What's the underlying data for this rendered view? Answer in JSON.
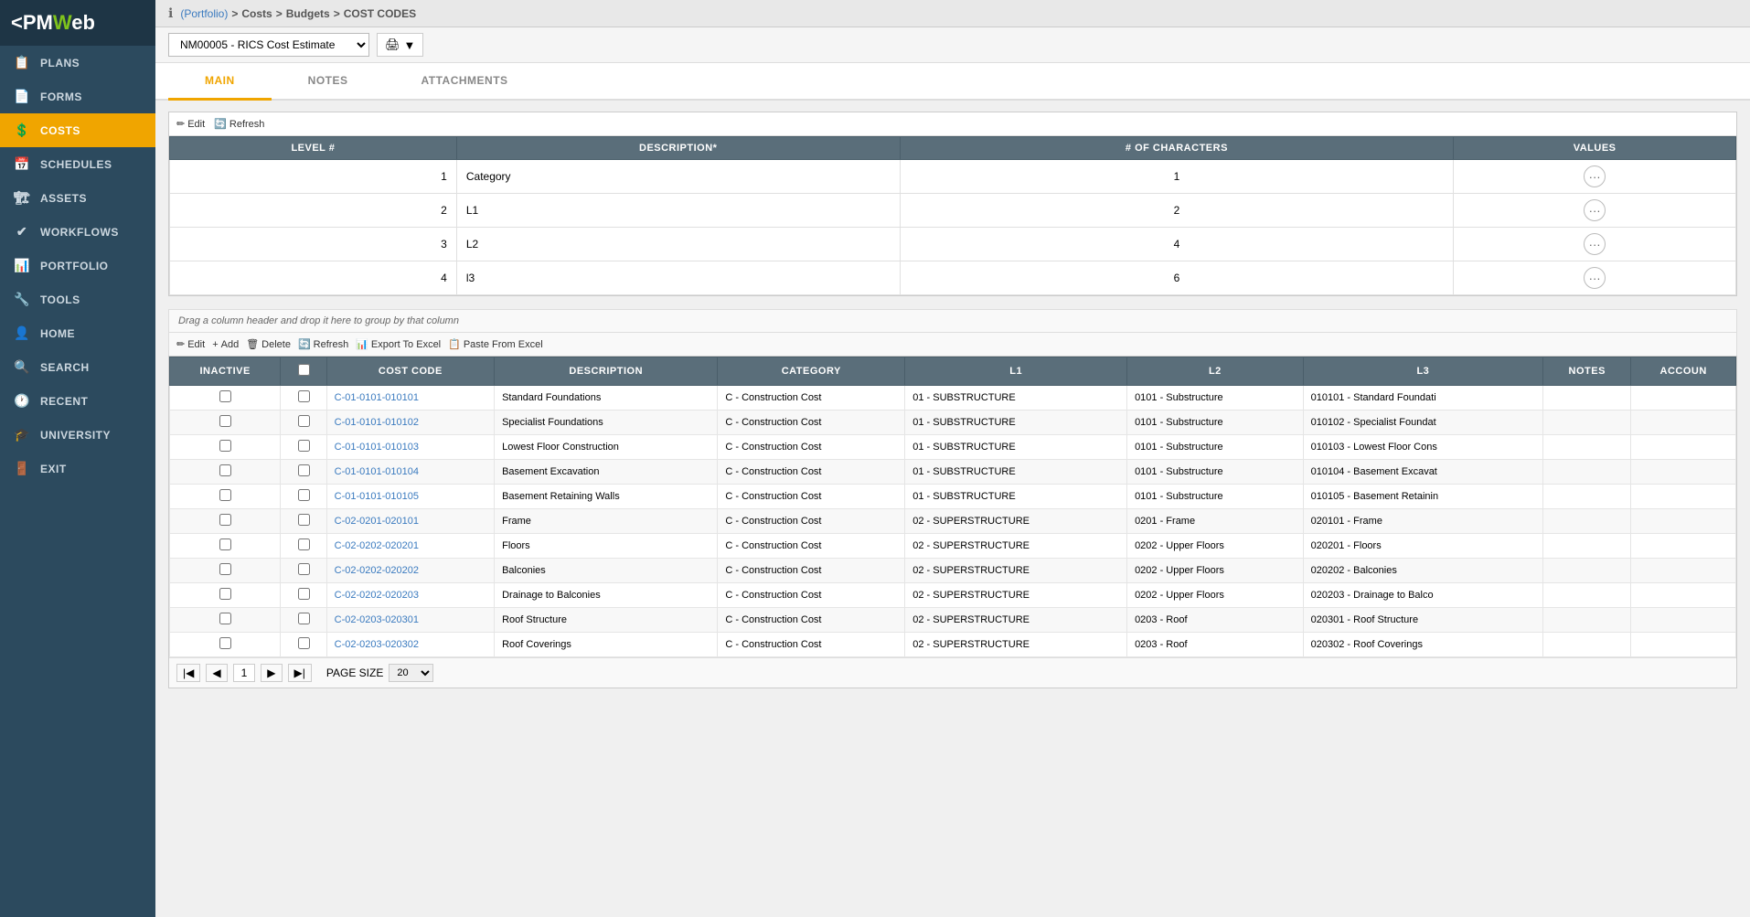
{
  "app": {
    "logo": "PMWeb",
    "logo_accent": "W"
  },
  "sidebar": {
    "items": [
      {
        "id": "plans",
        "label": "PLANS",
        "icon": "📋"
      },
      {
        "id": "forms",
        "label": "FORMS",
        "icon": "📄"
      },
      {
        "id": "costs",
        "label": "COSTS",
        "icon": "💲",
        "active": true
      },
      {
        "id": "schedules",
        "label": "SCHEDULES",
        "icon": "📅"
      },
      {
        "id": "assets",
        "label": "ASSETS",
        "icon": "🏗"
      },
      {
        "id": "workflows",
        "label": "WORKFLOWS",
        "icon": "✔"
      },
      {
        "id": "portfolio",
        "label": "PORTFOLIO",
        "icon": "📊"
      },
      {
        "id": "tools",
        "label": "TOOLS",
        "icon": "🔧"
      },
      {
        "id": "home",
        "label": "HOME",
        "icon": "👤"
      },
      {
        "id": "search",
        "label": "SEARCH",
        "icon": "🔍"
      },
      {
        "id": "recent",
        "label": "RECENT",
        "icon": "🕐"
      },
      {
        "id": "university",
        "label": "UNIVERSITY",
        "icon": "🎓"
      },
      {
        "id": "exit",
        "label": "EXIT",
        "icon": "🚪"
      }
    ]
  },
  "header": {
    "info_icon": "ℹ",
    "breadcrumb": [
      "(Portfolio)",
      "Costs",
      "Budgets",
      "COST CODES"
    ]
  },
  "toolbar": {
    "dropdown_value": "NM00005 - RICS Cost Estimate",
    "print_icon": "🖨",
    "dropdown_icon": "▼"
  },
  "tabs": [
    {
      "id": "main",
      "label": "MAIN",
      "active": true
    },
    {
      "id": "notes",
      "label": "NOTES"
    },
    {
      "id": "attachments",
      "label": "ATTACHMENTS"
    }
  ],
  "levels_section": {
    "edit_label": "Edit",
    "refresh_label": "Refresh",
    "columns": [
      "LEVEL #",
      "DESCRIPTION*",
      "# OF CHARACTERS",
      "VALUES"
    ],
    "rows": [
      {
        "level": "1",
        "description": "Category",
        "characters": "1"
      },
      {
        "level": "2",
        "description": "L1",
        "characters": "2"
      },
      {
        "level": "3",
        "description": "L2",
        "characters": "4"
      },
      {
        "level": "4",
        "description": "l3",
        "characters": "6"
      }
    ]
  },
  "costcodes_section": {
    "drag_text": "Drag a column header and drop it here to group by that column",
    "toolbar": {
      "edit": "Edit",
      "add": "Add",
      "delete": "Delete",
      "refresh": "Refresh",
      "export": "Export To Excel",
      "paste": "Paste From Excel"
    },
    "columns": [
      "INACTIVE",
      "",
      "COST CODE",
      "DESCRIPTION",
      "CATEGORY",
      "L1",
      "L2",
      "L3",
      "NOTES",
      "ACCOUN"
    ],
    "rows": [
      {
        "inactive": false,
        "code": "C-01-0101-010101",
        "description": "Standard Foundations",
        "category": "C - Construction Cost",
        "l1": "01 - SUBSTRUCTURE",
        "l2": "0101 - Substructure",
        "l3": "010101 - Standard Foundati",
        "notes": "",
        "account": ""
      },
      {
        "inactive": false,
        "code": "C-01-0101-010102",
        "description": "Specialist Foundations",
        "category": "C - Construction Cost",
        "l1": "01 - SUBSTRUCTURE",
        "l2": "0101 - Substructure",
        "l3": "010102 - Specialist Foundat",
        "notes": "",
        "account": ""
      },
      {
        "inactive": false,
        "code": "C-01-0101-010103",
        "description": "Lowest Floor Construction",
        "category": "C - Construction Cost",
        "l1": "01 - SUBSTRUCTURE",
        "l2": "0101 - Substructure",
        "l3": "010103 - Lowest Floor Cons",
        "notes": "",
        "account": ""
      },
      {
        "inactive": false,
        "code": "C-01-0101-010104",
        "description": "Basement Excavation",
        "category": "C - Construction Cost",
        "l1": "01 - SUBSTRUCTURE",
        "l2": "0101 - Substructure",
        "l3": "010104 - Basement Excavat",
        "notes": "",
        "account": ""
      },
      {
        "inactive": false,
        "code": "C-01-0101-010105",
        "description": "Basement Retaining Walls",
        "category": "C - Construction Cost",
        "l1": "01 - SUBSTRUCTURE",
        "l2": "0101 - Substructure",
        "l3": "010105 - Basement Retainin",
        "notes": "",
        "account": ""
      },
      {
        "inactive": false,
        "code": "C-02-0201-020101",
        "description": "Frame",
        "category": "C - Construction Cost",
        "l1": "02 - SUPERSTRUCTURE",
        "l2": "0201 - Frame",
        "l3": "020101 - Frame",
        "notes": "",
        "account": ""
      },
      {
        "inactive": false,
        "code": "C-02-0202-020201",
        "description": "Floors",
        "category": "C - Construction Cost",
        "l1": "02 - SUPERSTRUCTURE",
        "l2": "0202 - Upper Floors",
        "l3": "020201 - Floors",
        "notes": "",
        "account": ""
      },
      {
        "inactive": false,
        "code": "C-02-0202-020202",
        "description": "Balconies",
        "category": "C - Construction Cost",
        "l1": "02 - SUPERSTRUCTURE",
        "l2": "0202 - Upper Floors",
        "l3": "020202 - Balconies",
        "notes": "",
        "account": ""
      },
      {
        "inactive": false,
        "code": "C-02-0202-020203",
        "description": "Drainage to Balconies",
        "category": "C - Construction Cost",
        "l1": "02 - SUPERSTRUCTURE",
        "l2": "0202 - Upper Floors",
        "l3": "020203 - Drainage to Balco",
        "notes": "",
        "account": ""
      },
      {
        "inactive": false,
        "code": "C-02-0203-020301",
        "description": "Roof Structure",
        "category": "C - Construction Cost",
        "l1": "02 - SUPERSTRUCTURE",
        "l2": "0203 - Roof",
        "l3": "020301 - Roof Structure",
        "notes": "",
        "account": ""
      },
      {
        "inactive": false,
        "code": "C-02-0203-020302",
        "description": "Roof Coverings",
        "category": "C - Construction Cost",
        "l1": "02 - SUPERSTRUCTURE",
        "l2": "0203 - Roof",
        "l3": "020302 - Roof Coverings",
        "notes": "",
        "account": ""
      }
    ],
    "pagination": {
      "current_page": "1",
      "page_size": "20",
      "page_size_label": "PAGE SIZE"
    }
  },
  "colors": {
    "sidebar_bg": "#2c4a5e",
    "header_bg": "#5a6e7a",
    "active_tab": "#f0a500",
    "active_sidebar": "#f0a500",
    "link_color": "#3a7abf"
  }
}
